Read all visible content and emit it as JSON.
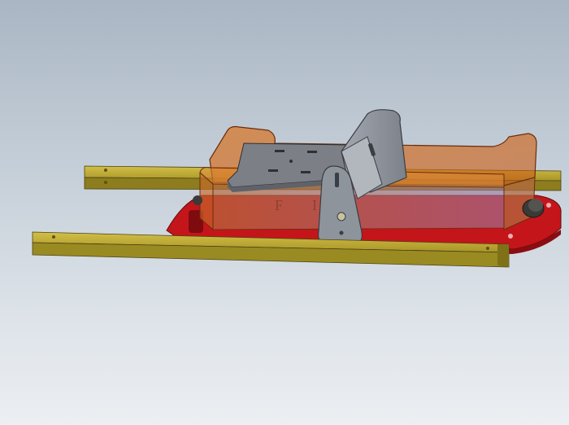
{
  "viewport": {
    "kind": "cad-3d-view",
    "background_colors": [
      "#a9b6c3",
      "#dde3e9"
    ]
  },
  "model": {
    "parts": [
      {
        "name": "rail-front",
        "color": "#b9a52f"
      },
      {
        "name": "rail-back",
        "color": "#b9a52f"
      },
      {
        "name": "base-plate",
        "color": "#c4151b"
      },
      {
        "name": "transparent-tray",
        "color": "#d46a1b"
      },
      {
        "name": "inner-plate",
        "color": "#7c7f86"
      },
      {
        "name": "clamp-bracket",
        "color": "#8e949c"
      },
      {
        "name": "adjust-knob",
        "color": "#3a3a38"
      }
    ],
    "engraved_letters": [
      "F",
      "I"
    ]
  }
}
